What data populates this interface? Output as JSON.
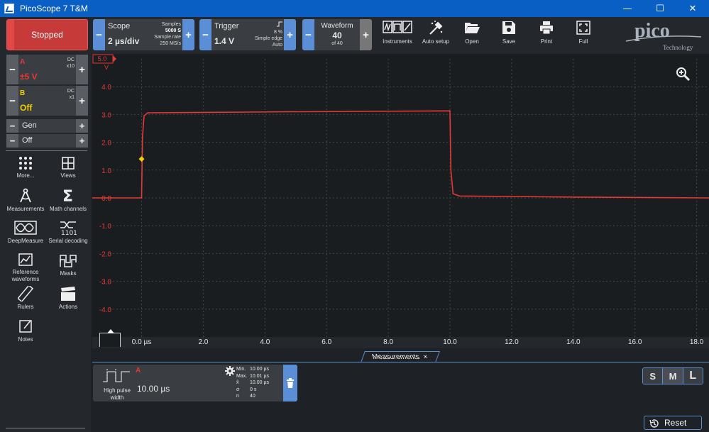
{
  "window": {
    "title": "PicoScope 7 T&M",
    "minimize": "—",
    "maximize": "☐",
    "close": "✕"
  },
  "status_button": {
    "label": "Stopped"
  },
  "channels": [
    {
      "name": "A",
      "value": "±5 V",
      "coupling": "DC",
      "probe": "x10",
      "color": "#e53935"
    },
    {
      "name": "B",
      "value": "Off",
      "coupling": "DC",
      "probe": "x1",
      "color": "#f2d000"
    }
  ],
  "generator": {
    "gen_label": "Gen",
    "off_label": "Off"
  },
  "tools": [
    {
      "label": "More...",
      "icon": "dots-grid-icon"
    },
    {
      "label": "Views",
      "icon": "views-grid-icon"
    },
    {
      "label": "Measurements",
      "icon": "compass-icon"
    },
    {
      "label": "Math channels",
      "icon": "sigma-icon"
    },
    {
      "label": "DeepMeasure",
      "icon": "deepmeasure-icon"
    },
    {
      "label": "Serial decoding",
      "icon": "serial-decoding-icon"
    },
    {
      "label": "Reference waveforms",
      "icon": "reference-waveform-icon"
    },
    {
      "label": "Masks",
      "icon": "masks-icon"
    },
    {
      "label": "Rulers",
      "icon": "ruler-icon"
    },
    {
      "label": "Actions",
      "icon": "clapperboard-icon"
    },
    {
      "label": "Notes",
      "icon": "notes-icon"
    }
  ],
  "scope": {
    "label": "Scope",
    "timebase": "2 µs/div",
    "samples_label": "Samples",
    "samples": "5000 S",
    "rate_label": "Sample rate",
    "rate": "250 MS/s"
  },
  "trigger": {
    "label": "Trigger",
    "level": "1.4 V",
    "percent": "8 %",
    "type": "Simple edge",
    "mode": "Auto"
  },
  "waveform": {
    "label": "Waveform",
    "current": "40",
    "of": "of 40"
  },
  "toolbar_buttons": [
    {
      "label": "Instruments",
      "icon": "instruments-icon"
    },
    {
      "label": "Auto setup",
      "icon": "auto-setup-icon"
    },
    {
      "label": "Open",
      "icon": "folder-open-icon"
    },
    {
      "label": "Save",
      "icon": "save-icon"
    },
    {
      "label": "Print",
      "icon": "printer-icon"
    },
    {
      "label": "Full",
      "icon": "fullscreen-icon"
    }
  ],
  "logo": {
    "text": "pico",
    "subtext": "Technology"
  },
  "chart_data": {
    "type": "line",
    "xlabel": "µs",
    "ylabel": "V",
    "range_label": "5.0",
    "xlim": [
      -1.6,
      18.4
    ],
    "ylim": [
      -5.0,
      5.0
    ],
    "x_ticks": [
      "0.0 µs",
      "2.0",
      "4.0",
      "6.0",
      "8.0",
      "10.0",
      "12.0",
      "14.0",
      "16.0",
      "18.0"
    ],
    "y_ticks": [
      "4.0",
      "3.0",
      "2.0",
      "1.0",
      "0.0",
      "-1.0",
      "-2.0",
      "-3.0",
      "-4.0",
      "-5.0"
    ],
    "grid": true,
    "series": [
      {
        "name": "A",
        "color": "#e53935",
        "x": [
          -1.6,
          0.0,
          0.03,
          0.08,
          0.2,
          5.0,
          10.0,
          10.03,
          10.1,
          10.3,
          14.0,
          18.4
        ],
        "y": [
          0.0,
          0.0,
          2.2,
          2.95,
          3.06,
          3.1,
          3.13,
          1.0,
          0.15,
          0.07,
          0.03,
          0.0
        ]
      }
    ],
    "trigger_marker": {
      "x": 0.0,
      "y": 1.4,
      "color": "#f2d000"
    }
  },
  "measurements_tab": {
    "label": "Measurements",
    "close": "×"
  },
  "measurement": {
    "channel": "A",
    "name": "High pulse width",
    "value": "10.00 µs",
    "stats": [
      {
        "k": "Min.",
        "v": "10.00 µs"
      },
      {
        "k": "Max.",
        "v": "10.01 µs"
      },
      {
        "k": "x̃",
        "v": "10.00 µs"
      },
      {
        "k": "σ",
        "v": "0 s"
      },
      {
        "k": "n",
        "v": "40"
      }
    ]
  },
  "size_selector": {
    "options": [
      "S",
      "M",
      "L"
    ],
    "selected": "M"
  },
  "reset_button": {
    "label": "Reset"
  }
}
